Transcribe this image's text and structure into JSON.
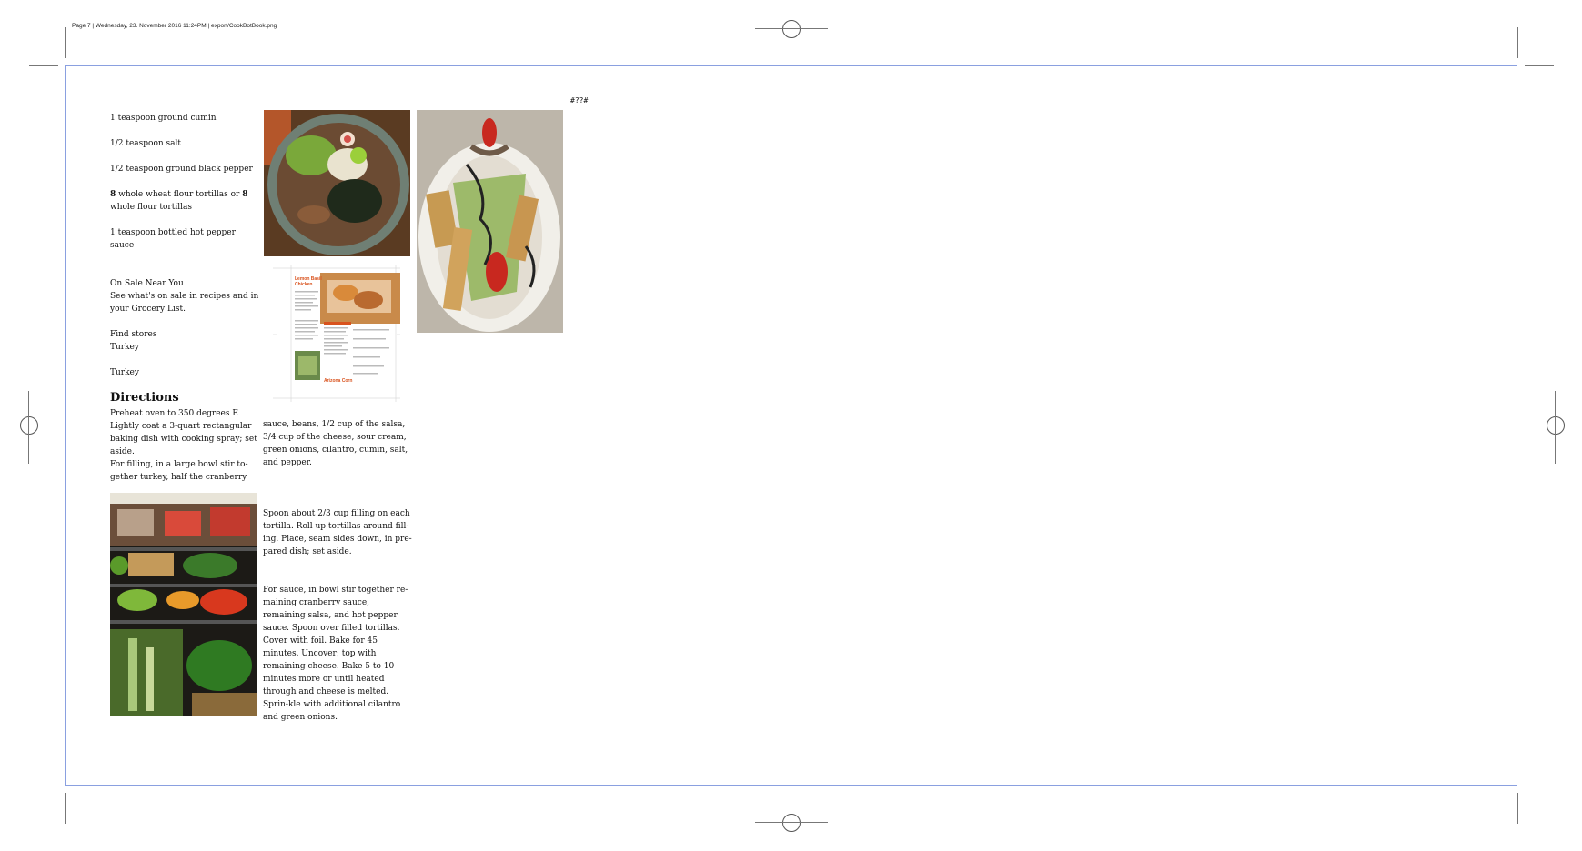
{
  "header": {
    "line": "Page 7 | Wednesday, 23. November 2016 11:24PM | export/CookBotBook.png"
  },
  "page_marker": "#??#",
  "ingredients": [
    "1 teaspoon ground cumin",
    "1/2 teaspoon salt",
    "1/2 teaspoon ground black pepper"
  ],
  "tortillas": {
    "num1": "8",
    "mid": " whole wheat flour tortillas or ",
    "num2": "8",
    "tail": "whole flour tortillas"
  },
  "hot_sauce": "1 teaspoon bottled hot pepper sauce",
  "promo": {
    "title": "On Sale Near You",
    "body": "See what's on sale in recipes and in your Grocery List."
  },
  "stores": {
    "find": "Find stores",
    "t1": " Turkey",
    "t2": "Turkey"
  },
  "directions": {
    "heading": "Directions",
    "p1": " Preheat oven to 350 degrees F. Lightly coat a 3-quart rectangular baking dish with cooking spray; set aside.",
    "p2": "For filling, in a large bowl stir to-gether turkey, half the cranberry",
    "p2b": "sauce, beans, 1/2 cup of the salsa, 3/4 cup of the cheese, sour cream, green onions, cilantro, cumin, salt, and pepper.",
    "p3": "Spoon about 2/3 cup filling on each tortilla. Roll up tortillas around fill-ing. Place, seam sides down, in pre-pared dish; set aside.",
    "p4": "For sauce, in bowl stir together re-maining cranberry sauce, remaining salsa, and hot pepper sauce. Spoon over filled tortillas. Cover with foil. Bake for 45 minutes. Uncover; top with remaining cheese. Bake 5 to 10 minutes more or until heated through and cheese is melted. Sprin-kle with additional cilantro and green onions."
  },
  "thumb": {
    "title1": "Lemon Basil",
    "title2": "Chicken",
    "title3": "Arizona Corn"
  },
  "colors": {
    "frame": "#8aa0e0",
    "thumb_title": "#d9531e"
  }
}
